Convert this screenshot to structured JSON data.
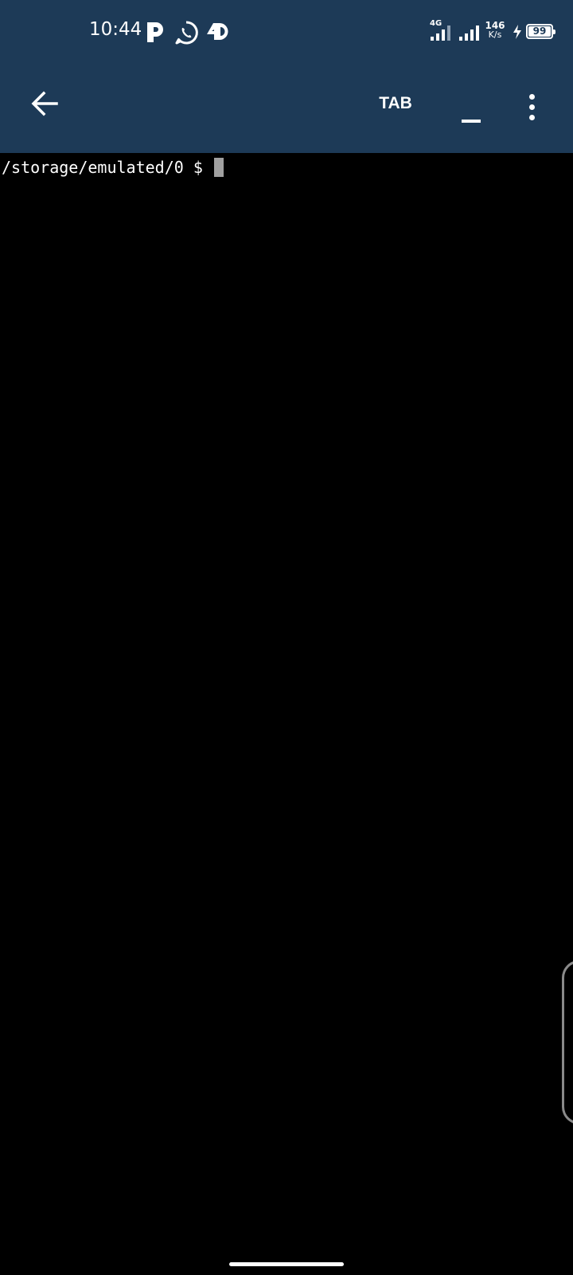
{
  "status_bar": {
    "time": "10:44",
    "network_type": "4G",
    "net_speed_value": "146",
    "net_speed_unit": "K/s",
    "battery_level": "99",
    "notification_icons": [
      "p-app-icon",
      "whatsapp-icon",
      "4d-app-icon"
    ]
  },
  "app_bar": {
    "tab_label": "TAB",
    "underscore_label": "_"
  },
  "terminal": {
    "prompt": "/storage/emulated/0 $ "
  },
  "colors": {
    "header_bg": "#1d3a57",
    "terminal_bg": "#000000",
    "text": "#ffffff",
    "cursor": "#a0a0a0"
  }
}
